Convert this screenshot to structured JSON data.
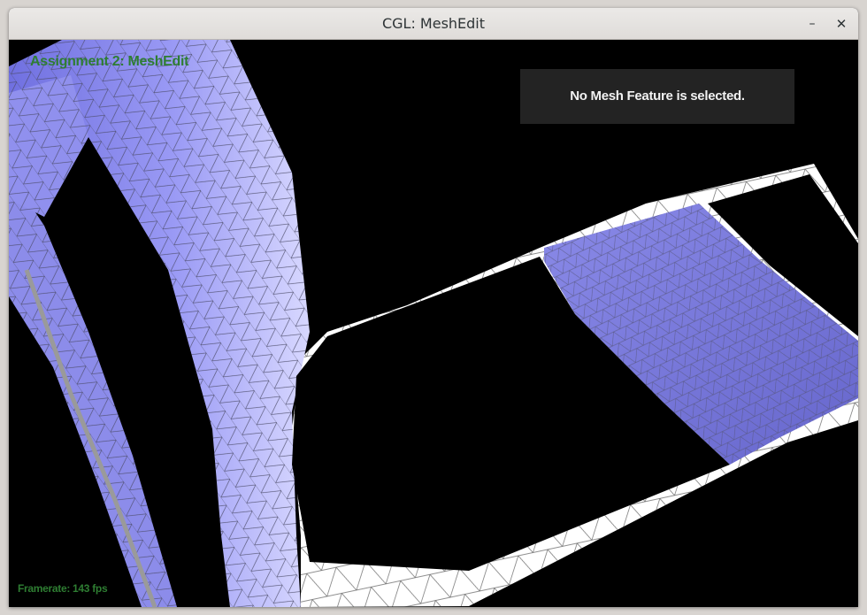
{
  "window": {
    "title": "CGL: MeshEdit",
    "minimize_glyph": "–",
    "close_glyph": "✕"
  },
  "overlay": {
    "app_title": "Assignment 2: MeshEdit",
    "info_text": "No Mesh Feature is selected.",
    "framerate": "Framerate: 143 fps"
  },
  "colors": {
    "overlay_text": "#2e7d32",
    "mesh_light": "#ffffff",
    "mesh_shade": "#8888f0",
    "wire": "#5a5a5a",
    "background": "#000000"
  }
}
